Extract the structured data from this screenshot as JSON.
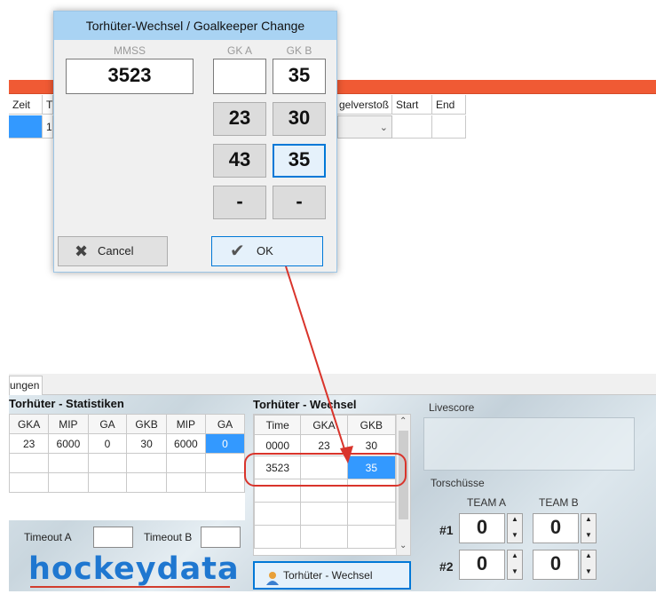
{
  "background_app": {
    "grid_headers": [
      "Zeit",
      "T",
      "gelverstoß",
      "Start",
      "End"
    ],
    "row_cell_partial": "1"
  },
  "dialog": {
    "title": "Torhüter-Wechsel / Goalkeeper Change",
    "mmss_label": "MMSS",
    "mmss_value": "3523",
    "gk_a_label": "GK A",
    "gk_b_label": "GK B",
    "gk_a_value": "",
    "gk_b_value": "35",
    "gk_a_options": [
      "23",
      "43",
      "-"
    ],
    "gk_b_options": [
      "30",
      "35",
      "-"
    ],
    "cancel_label": "Cancel",
    "ok_label": "OK"
  },
  "bottom": {
    "tab_label": "ungen",
    "stats": {
      "title": "Torhüter - Statistiken",
      "headers": [
        "GKA",
        "MIP",
        "GA",
        "GKB",
        "MIP",
        "GA"
      ],
      "row": [
        "23",
        "6000",
        "0",
        "30",
        "6000",
        "0"
      ]
    },
    "timeout_a_label": "Timeout A",
    "timeout_b_label": "Timeout B",
    "logo": "hockeydata",
    "changes": {
      "title": "Torhüter - Wechsel",
      "headers": [
        "Time",
        "GKA",
        "GKB"
      ],
      "rows": [
        [
          "0000",
          "23",
          "30"
        ],
        [
          "3523",
          "",
          "35"
        ]
      ],
      "button_label": "Torhüter - Wechsel"
    },
    "livescore_label": "Livescore",
    "torschuesse": {
      "title": "Torschüsse",
      "team_a": "TEAM A",
      "team_b": "TEAM B",
      "row1_label": "#1",
      "row2_label": "#2",
      "row1_a": "0",
      "row1_b": "0",
      "row2_a": "0",
      "row2_b": "0"
    }
  },
  "colors": {
    "accent_blue": "#0078d7",
    "selection_blue": "#3399ff",
    "title_bar": "#a9d3f3",
    "red_bar": "#f05a34",
    "annotation_red": "#d9342b"
  }
}
